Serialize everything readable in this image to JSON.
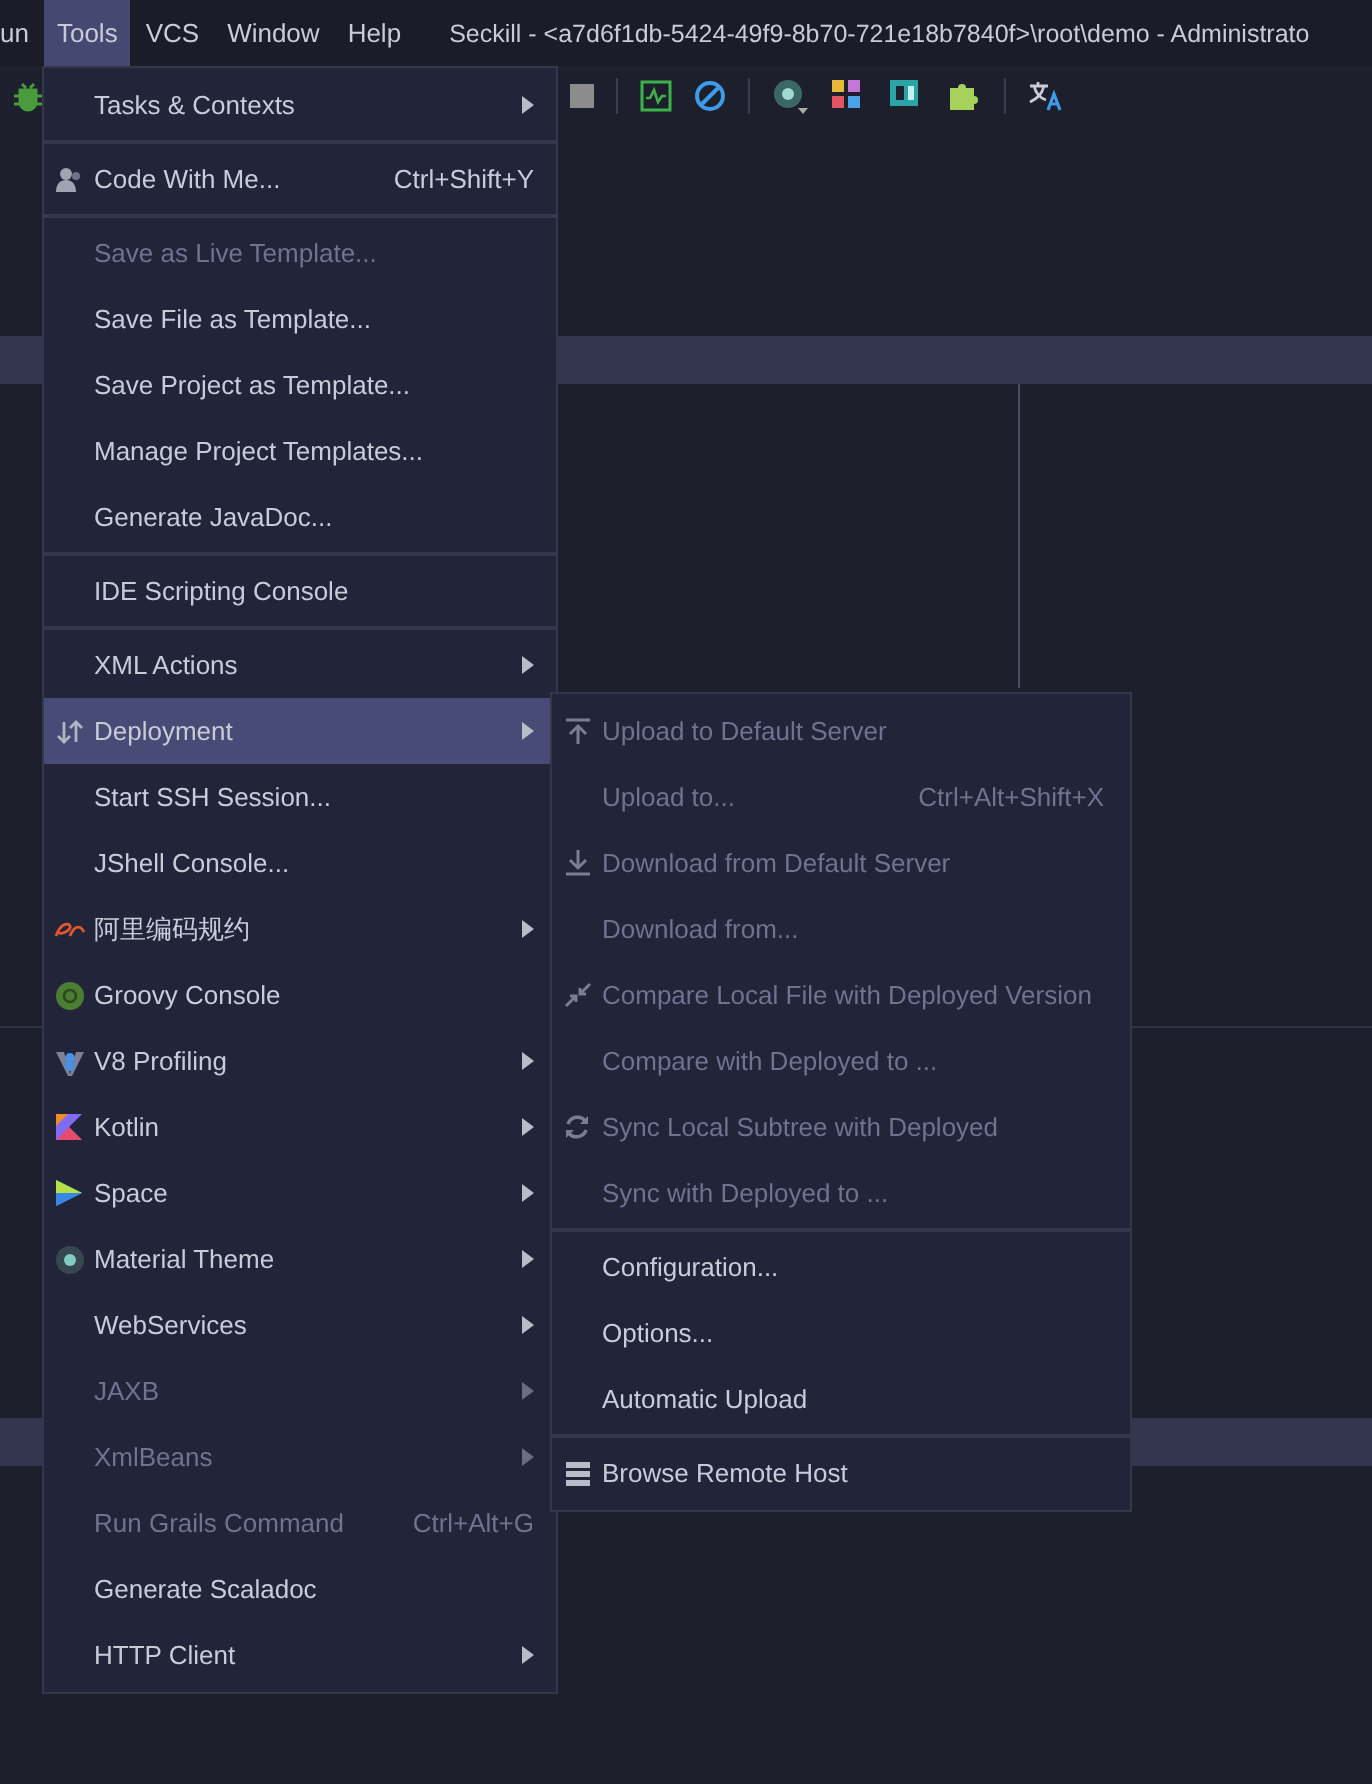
{
  "menu_bar": {
    "items": [
      {
        "label": "un",
        "selected": false
      },
      {
        "label": "Tools",
        "selected": true
      },
      {
        "label": "VCS",
        "selected": false
      },
      {
        "label": "Window",
        "selected": false
      },
      {
        "label": "Help",
        "selected": false
      }
    ],
    "title": "Seckill - <a7d6f1db-5424-49f9-8b70-721e18b7840f>\\root\\demo - Administrato"
  },
  "tools_menu": {
    "groups": [
      [
        {
          "label": "Tasks & Contexts",
          "submenu": true,
          "disabled": false,
          "selected": false
        }
      ],
      [
        {
          "label": "Code With Me...",
          "shortcut": "Ctrl+Shift+Y",
          "submenu": false,
          "disabled": false,
          "selected": false
        }
      ],
      [
        {
          "label": "Save as Live Template...",
          "submenu": false,
          "disabled": true,
          "selected": false
        },
        {
          "label": "Save File as Template...",
          "submenu": false,
          "disabled": false,
          "selected": false
        },
        {
          "label": "Save Project as Template...",
          "submenu": false,
          "disabled": false,
          "selected": false
        },
        {
          "label": "Manage Project Templates...",
          "submenu": false,
          "disabled": false,
          "selected": false
        },
        {
          "label": "Generate JavaDoc...",
          "submenu": false,
          "disabled": false,
          "selected": false
        }
      ],
      [
        {
          "label": "IDE Scripting Console",
          "submenu": false,
          "disabled": false,
          "selected": false
        }
      ],
      [
        {
          "label": "XML Actions",
          "submenu": true,
          "disabled": false,
          "selected": false
        },
        {
          "label": "Deployment",
          "submenu": true,
          "disabled": false,
          "selected": true
        },
        {
          "label": "Start SSH Session...",
          "submenu": false,
          "disabled": false,
          "selected": false
        },
        {
          "label": "JShell Console...",
          "submenu": false,
          "disabled": false,
          "selected": false
        },
        {
          "label": "阿里编码规约",
          "submenu": true,
          "disabled": false,
          "selected": false
        },
        {
          "label": "Groovy Console",
          "submenu": false,
          "disabled": false,
          "selected": false
        },
        {
          "label": "V8 Profiling",
          "submenu": true,
          "disabled": false,
          "selected": false
        },
        {
          "label": "Kotlin",
          "submenu": true,
          "disabled": false,
          "selected": false
        },
        {
          "label": "Space",
          "submenu": true,
          "disabled": false,
          "selected": false
        },
        {
          "label": "Material Theme",
          "submenu": true,
          "disabled": false,
          "selected": false
        },
        {
          "label": "WebServices",
          "submenu": true,
          "disabled": false,
          "selected": false
        },
        {
          "label": "JAXB",
          "submenu": true,
          "disabled": true,
          "selected": false
        },
        {
          "label": "XmlBeans",
          "submenu": true,
          "disabled": true,
          "selected": false
        },
        {
          "label": "Run Grails Command",
          "shortcut": "Ctrl+Alt+G",
          "submenu": false,
          "disabled": true,
          "selected": false
        },
        {
          "label": "Generate Scaladoc",
          "submenu": false,
          "disabled": false,
          "selected": false
        },
        {
          "label": "HTTP Client",
          "submenu": true,
          "disabled": false,
          "selected": false
        }
      ]
    ]
  },
  "deployment_submenu": {
    "groups": [
      [
        {
          "label": "Upload to Default Server",
          "disabled": true
        },
        {
          "label": "Upload to...",
          "shortcut": "Ctrl+Alt+Shift+X",
          "disabled": true
        },
        {
          "label": "Download from Default Server",
          "disabled": true
        },
        {
          "label": "Download from...",
          "disabled": true
        },
        {
          "label": "Compare Local File with Deployed Version",
          "disabled": true
        },
        {
          "label": "Compare with Deployed to ...",
          "disabled": true
        },
        {
          "label": "Sync Local Subtree with Deployed",
          "disabled": true
        },
        {
          "label": "Sync with Deployed to ...",
          "disabled": true
        }
      ],
      [
        {
          "label": "Configuration...",
          "disabled": false
        },
        {
          "label": "Options...",
          "disabled": false
        },
        {
          "label": "Automatic Upload",
          "disabled": false
        }
      ],
      [
        {
          "label": "Browse Remote Host",
          "disabled": false
        }
      ]
    ]
  }
}
